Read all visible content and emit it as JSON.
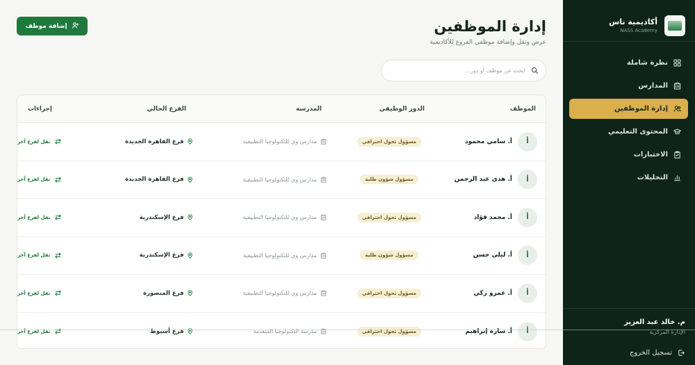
{
  "brand": {
    "title": "أكاديمية ناس",
    "subtitle": "NASS Academy"
  },
  "nav": [
    {
      "label": "نظرة شاملة",
      "icon": "grid-icon",
      "active": false
    },
    {
      "label": "المدارس",
      "icon": "building-icon",
      "active": false
    },
    {
      "label": "إدارة الموظفين",
      "icon": "users-icon",
      "active": true
    },
    {
      "label": "المحتوى التعليمي",
      "icon": "graduation-cap-icon",
      "active": false
    },
    {
      "label": "الاختبارات",
      "icon": "clipboard-icon",
      "active": false
    },
    {
      "label": "التحليلات",
      "icon": "bar-chart-icon",
      "active": false
    }
  ],
  "user": {
    "name": "م. خالد عبد العزيز",
    "role": "الإدارة المركزية",
    "logout": "تسجيل الخروج"
  },
  "page": {
    "title": "إدارة الموظفين",
    "subtitle": "عرض ونقل وإضافة موظفي الفروع للأكاديمية",
    "add_button": "إضافة موظف"
  },
  "search": {
    "placeholder": "ابحث عن موظف أو دور..."
  },
  "table": {
    "headers": {
      "employee": "الموظف",
      "role": "الدور الوظيفي",
      "school": "المدرسة",
      "branch": "الفرع الحالي",
      "actions": "إجراءات"
    },
    "rows": [
      {
        "avatar": "أ",
        "name": "أ. سامي محمود",
        "role": "مسؤول تحول احترافي",
        "school": "مدارس وي للتكنولوجيا التطبيقية",
        "branch": "فرع القاهرة الجديدة",
        "action": "نقل لفرع آخر"
      },
      {
        "avatar": "أ",
        "name": "أ. هدى عبد الرحمن",
        "role": "مسؤول شؤون طلبة",
        "school": "مدارس وي للتكنولوجيا التطبيقية",
        "branch": "فرع القاهرة الجديدة",
        "action": "نقل لفرع آخر"
      },
      {
        "avatar": "أ",
        "name": "أ. محمد فؤاد",
        "role": "مسؤول تحول احترافي",
        "school": "مدارس وي للتكنولوجيا التطبيقية",
        "branch": "فرع الإسكندرية",
        "action": "نقل لفرع آخر"
      },
      {
        "avatar": "أ",
        "name": "أ. ليلى حسن",
        "role": "مسؤول شؤون طلبة",
        "school": "مدارس وي للتكنولوجيا التطبيقية",
        "branch": "فرع الإسكندرية",
        "action": "نقل لفرع آخر"
      },
      {
        "avatar": "أ",
        "name": "أ. عمرو زكي",
        "role": "مسؤول تحول احترافي",
        "school": "مدارس وي للتكنولوجيا التطبيقية",
        "branch": "فرع المنصورة",
        "action": "نقل لفرع آخر"
      },
      {
        "avatar": "أ",
        "name": "أ. سارة إبراهيم",
        "role": "مسؤول تحول احترافي",
        "school": "مدرسة التكنولوجيا المتقدمة",
        "branch": "فرع أسيوط",
        "action": "نقل لفرع آخر"
      }
    ]
  },
  "colors": {
    "sidebar_bg": "#0f2418",
    "accent_gold": "#d9b04a",
    "primary_green": "#1e7a3c"
  }
}
